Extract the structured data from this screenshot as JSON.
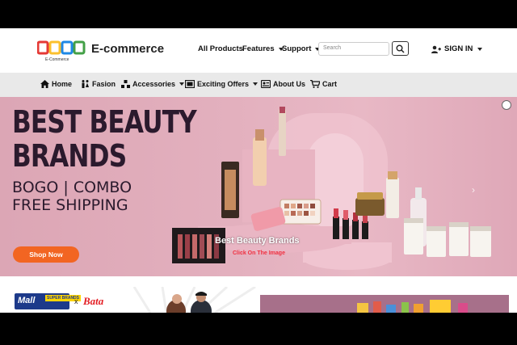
{
  "header": {
    "brand": "E-commerce",
    "logo_sub": "E-Commerce",
    "nav": [
      {
        "label": "All Products",
        "dropdown": false
      },
      {
        "label": "Features",
        "dropdown": true
      },
      {
        "label": "Support",
        "dropdown": true
      }
    ],
    "search_placeholder": "Search",
    "signin_label": "SIGN IN"
  },
  "subnav": [
    {
      "label": "Home",
      "icon": "home-icon"
    },
    {
      "label": "Fasion",
      "icon": "people-icon"
    },
    {
      "label": "Accessories",
      "icon": "accessories-icon"
    },
    {
      "label": "Exciting Offers",
      "icon": "offer-icon"
    },
    {
      "label": "About Us",
      "icon": "id-card-icon"
    },
    {
      "label": "Cart",
      "icon": "cart-icon"
    }
  ],
  "hero": {
    "title_line1": "BEST BEAUTY",
    "title_line2": "BRANDS",
    "offer_line1": "BOGO | COMBO",
    "offer_line2": "FREE SHIPPING",
    "cta_label": "Shop Now",
    "caption": "Best Beauty Brands",
    "sub_caption": "Click On The Image"
  },
  "promo": {
    "mall_label": "Mall",
    "super_label": "SUPER BRANDS",
    "cross": "x",
    "partner": "Bata"
  },
  "colors": {
    "accent": "#f26522",
    "hero_bg": "#e3b0be",
    "title": "#2b1a2d",
    "subnav_bg": "#e9e9e9"
  }
}
